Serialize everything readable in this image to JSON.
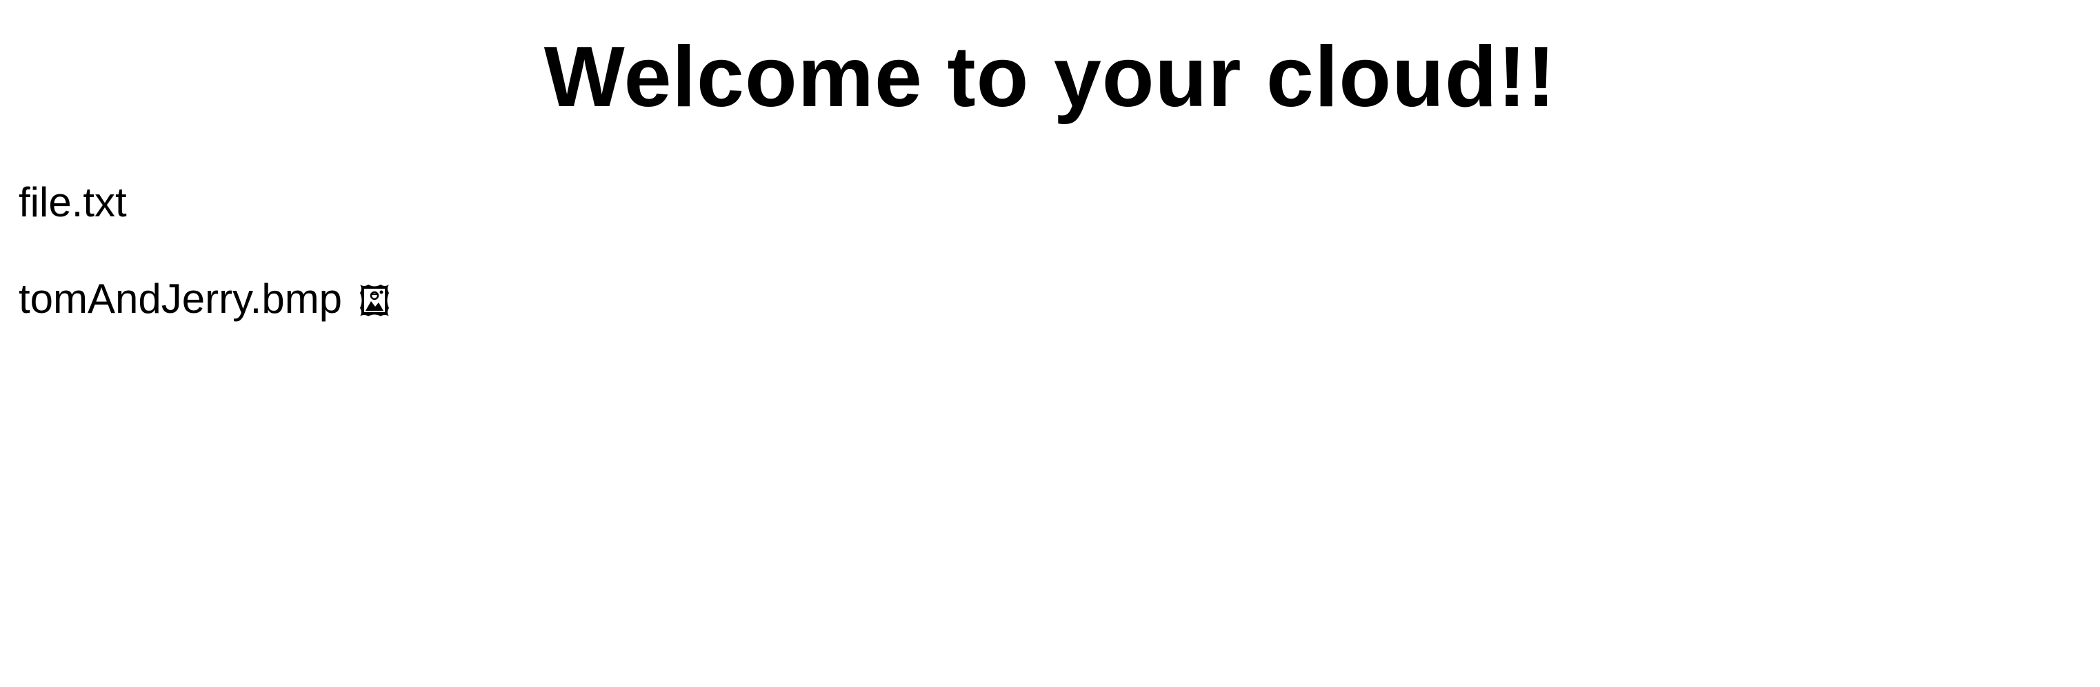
{
  "header": {
    "title": "Welcome to your cloud!!"
  },
  "files": [
    {
      "name": "file.txt",
      "icon": ""
    },
    {
      "name": "tomAndJerry.bmp",
      "icon": "framed-picture-icon"
    }
  ]
}
